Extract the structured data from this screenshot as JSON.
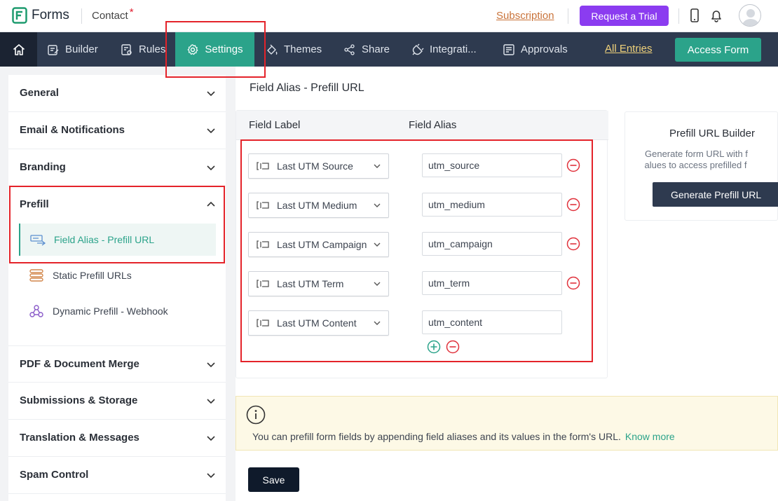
{
  "topbar": {
    "brand": "Forms",
    "form_name": "Contact",
    "required_mark": "*",
    "subscription_link": "Subscription",
    "trial_button": "Request a Trial"
  },
  "nav": {
    "items": [
      "Builder",
      "Rules",
      "Settings",
      "Themes",
      "Share",
      "Integrati...",
      "Approvals"
    ],
    "all_entries": "All Entries",
    "access_form": "Access Form"
  },
  "sidebar": {
    "sections_top": [
      "General",
      "Email & Notifications",
      "Branding"
    ],
    "prefill": {
      "label": "Prefill",
      "items": [
        "Field Alias - Prefill URL",
        "Static Prefill URLs",
        "Dynamic Prefill - Webhook"
      ]
    },
    "sections_bottom": [
      "PDF & Document Merge",
      "Submissions & Storage",
      "Translation & Messages",
      "Spam Control"
    ]
  },
  "main": {
    "title": "Field Alias - Prefill URL",
    "col_label": "Field Label",
    "col_alias": "Field Alias",
    "rows": [
      {
        "label": "Last UTM Source",
        "alias": "utm_source"
      },
      {
        "label": "Last UTM Medium",
        "alias": "utm_medium"
      },
      {
        "label": "Last UTM Campaign",
        "alias": "utm_campaign"
      },
      {
        "label": "Last UTM Term",
        "alias": "utm_term"
      },
      {
        "label": "Last UTM Content",
        "alias": "utm_content"
      }
    ],
    "builder": {
      "title": "Prefill URL Builder",
      "desc_line1": "Generate form URL with f",
      "desc_line2": "values to access prefilled f",
      "button": "Generate Prefill URL"
    },
    "info": {
      "text": "You can prefill form fields by appending field aliases and its values in the form's URL.",
      "link": "Know more"
    },
    "save": "Save"
  },
  "colors": {
    "accent": "#2ba38a",
    "nav_bg": "#2e3a4f",
    "trial": "#8b3cf0",
    "highlight": "#e4232a",
    "remove": "#e0323c"
  }
}
